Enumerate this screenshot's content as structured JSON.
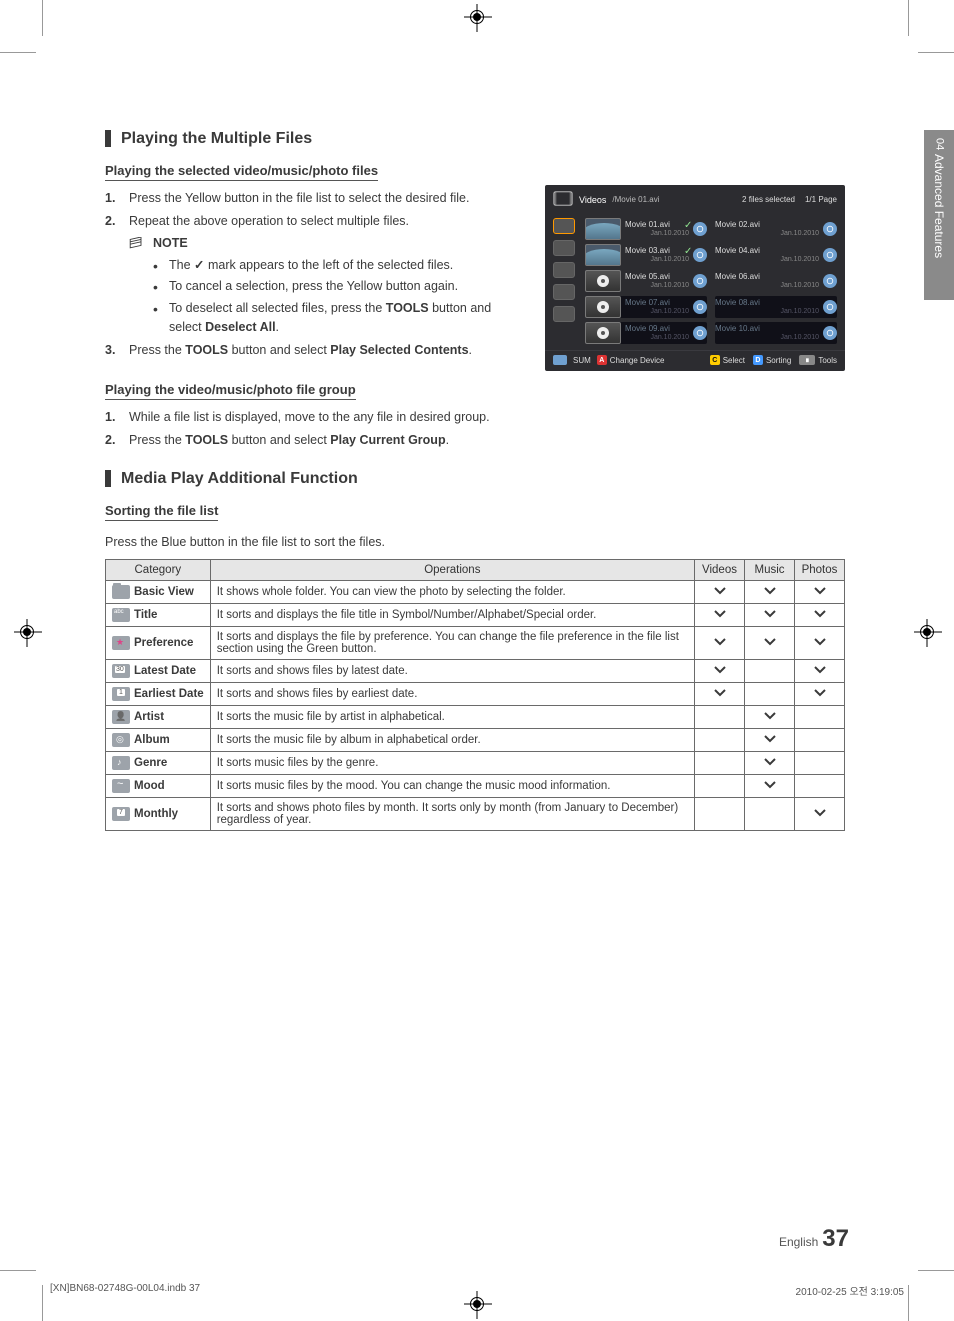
{
  "side_tab": {
    "num": "04",
    "label": "Advanced Features"
  },
  "sections": {
    "playing_multiple": "Playing the Multiple Files",
    "media_play": "Media Play Additional Function"
  },
  "subsections": {
    "selected_files": "Playing the selected video/music/photo files",
    "file_group": "Playing the video/music/photo file group",
    "sorting": "Sorting the file list"
  },
  "note_label": "NOTE",
  "steps_selected": [
    "Press the Yellow button in the file list to select the desired file.",
    "Repeat the above operation to select multiple files."
  ],
  "notes_selected": {
    "n1_a": "The ",
    "n1_b": " mark appears to the left of the selected files.",
    "n2": "To cancel a selection, press the Yellow button again.",
    "n3_a": "To deselect all selected files, press the ",
    "n3_b": "TOOLS",
    "n3_c": " button and select ",
    "n3_d": "Deselect All",
    "n3_e": "."
  },
  "step3": {
    "a": "Press the ",
    "tools": "TOOLS",
    "b": " button and select ",
    "play": "Play Selected Contents",
    "c": "."
  },
  "steps_group": [
    "While a file list is displayed, move to the any file in desired group."
  ],
  "steps_group_2": {
    "a": "Press the ",
    "tools": "TOOLS",
    "b": " button and select ",
    "play": "Play Current Group",
    "c": "."
  },
  "sorting_intro": "Press the Blue button in the file list to sort the files.",
  "table": {
    "headers": {
      "cat": "Category",
      "ops": "Operations",
      "videos": "Videos",
      "music": "Music",
      "photos": "Photos"
    },
    "rows": [
      {
        "icon": "folder",
        "cat": "Basic View",
        "ops": "It shows whole folder. You can view the photo by selecting the folder.",
        "v": true,
        "m": true,
        "p": true
      },
      {
        "icon": "title",
        "cat": "Title",
        "ops": "It sorts and displays the file title in Symbol/Number/Alphabet/Special order.",
        "v": true,
        "m": true,
        "p": true
      },
      {
        "icon": "pref",
        "cat": "Preference",
        "ops": "It sorts and displays the file by preference. You can change the file preference in the file list section using the Green button.",
        "v": true,
        "m": true,
        "p": true
      },
      {
        "icon": "date30",
        "cat": "Latest Date",
        "ops": "It sorts and shows files by latest date.",
        "v": true,
        "m": false,
        "p": true
      },
      {
        "icon": "date1",
        "cat": "Earliest Date",
        "ops": "It sorts and shows files by earliest date.",
        "v": true,
        "m": false,
        "p": true
      },
      {
        "icon": "artist",
        "cat": "Artist",
        "ops": "It sorts the music file by artist in alphabetical.",
        "v": false,
        "m": true,
        "p": false
      },
      {
        "icon": "album",
        "cat": "Album",
        "ops": "It sorts the music file by album in alphabetical order.",
        "v": false,
        "m": true,
        "p": false
      },
      {
        "icon": "genre",
        "cat": "Genre",
        "ops": "It sorts music files by the genre.",
        "v": false,
        "m": true,
        "p": false
      },
      {
        "icon": "mood",
        "cat": "Mood",
        "ops": "It sorts music files by the mood. You can change the music mood information.",
        "v": false,
        "m": true,
        "p": false
      },
      {
        "icon": "monthly",
        "cat": "Monthly",
        "ops": "It sorts and shows photo files by month. It sorts only by month (from January to December) regardless of year.",
        "v": false,
        "m": false,
        "p": true
      }
    ]
  },
  "screenshot": {
    "header_title": "Videos",
    "header_path": "/Movie 01.avi",
    "header_selected": "2 files selected",
    "header_page": "1/1 Page",
    "tiles": [
      {
        "name": "Movie 01.avi",
        "date": "Jan.10.2010",
        "chk": true,
        "photo": true,
        "col": 0
      },
      {
        "name": "Movie 02.avi",
        "date": "Jan.10.2010",
        "chk": false,
        "photo": false,
        "col": 1
      },
      {
        "name": "Movie 03.avi",
        "date": "Jan.10.2010",
        "chk": true,
        "photo": true,
        "col": 0
      },
      {
        "name": "Movie 04.avi",
        "date": "Jan.10.2010",
        "chk": false,
        "photo": false,
        "col": 1
      },
      {
        "name": "Movie 05.avi",
        "date": "Jan.10.2010",
        "chk": false,
        "photo": false,
        "col": 0
      },
      {
        "name": "Movie 06.avi",
        "date": "Jan.10.2010",
        "chk": false,
        "photo": false,
        "col": 1
      },
      {
        "name": "Movie 07.avi",
        "date": "Jan.10.2010",
        "chk": false,
        "photo": false,
        "col": 0,
        "sel": true
      },
      {
        "name": "Movie 08.avi",
        "date": "Jan.10.2010",
        "chk": false,
        "photo": false,
        "col": 1,
        "sel": true
      },
      {
        "name": "Movie 09.avi",
        "date": "Jan.10.2010",
        "chk": false,
        "photo": false,
        "col": 0,
        "sel": true
      },
      {
        "name": "Movie 10.avi",
        "date": "Jan.10.2010",
        "chk": false,
        "photo": false,
        "col": 1,
        "sel": true
      }
    ],
    "footer": {
      "sum": "SUM",
      "change": "Change Device",
      "select": "Select",
      "sorting": "Sorting",
      "tools": "Tools"
    }
  },
  "footer": {
    "lang": "English",
    "page": "37"
  },
  "metaline": {
    "left": "[XN]BN68-02748G-00L04.indb   37",
    "right": "2010-02-25   오전 3:19:05"
  }
}
